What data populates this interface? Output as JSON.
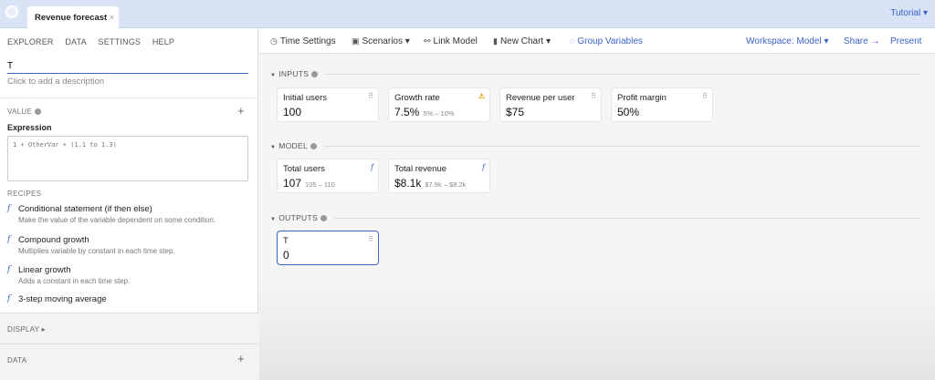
{
  "tabs": {
    "active_tab": "Revenue forecast",
    "close_glyph": "×",
    "tutorial_label": "Tutorial ▾"
  },
  "sidebar": {
    "nav": [
      "EXPLORER",
      "DATA",
      "SETTINGS",
      "HELP"
    ],
    "name_value": "T",
    "description_placeholder": "Click to add a description",
    "value_label": "VALUE",
    "expression_label": "Expression",
    "expression_placeholder": "1 + OtherVar + (1.1 to 1.3)",
    "recipes_label": "RECIPES",
    "recipes": [
      {
        "title": "Conditional statement (if then else)",
        "desc": "Make the value of the variable dependent on some condition."
      },
      {
        "title": "Compound growth",
        "desc": "Multiplies variable by constant in each time step."
      },
      {
        "title": "Linear growth",
        "desc": "Adds a constant in each time step."
      },
      {
        "title": "3-step moving average",
        "desc": ""
      }
    ],
    "display_label": "DISPLAY ▸",
    "data_label": "DATA"
  },
  "toolbar": {
    "time_settings": "Time Settings",
    "scenarios": "Scenarios ▾",
    "link_model": "Link Model",
    "new_chart": "New Chart ▾",
    "group_variables": "Group Variables",
    "workspace": "Workspace: Model ▾",
    "share": "Share →",
    "present": "Present"
  },
  "canvas": {
    "inputs": {
      "label": "INPUTS",
      "cards": [
        {
          "name": "Initial users",
          "value": "100",
          "range": "",
          "icon": "grid-icon"
        },
        {
          "name": "Growth rate",
          "value": "7.5%",
          "range": "5% – 10%",
          "icon": "warning-icon"
        },
        {
          "name": "Revenue per user",
          "value": "$75",
          "range": "",
          "icon": "grid-icon"
        },
        {
          "name": "Profit margin",
          "value": "50%",
          "range": "",
          "icon": "grid-icon"
        }
      ]
    },
    "model": {
      "label": "MODEL",
      "cards": [
        {
          "name": "Total users",
          "value": "107",
          "range": "105 – 110",
          "icon": "function-icon"
        },
        {
          "name": "Total revenue",
          "value": "$8.1k",
          "range": "$7.9k – $8.2k",
          "icon": "function-icon"
        }
      ]
    },
    "outputs": {
      "label": "OUTPUTS",
      "cards": [
        {
          "name": "T",
          "value": "0",
          "range": "",
          "icon": "grid-icon"
        }
      ]
    }
  },
  "colors": {
    "accent": "#3a62c8",
    "warning": "#e3a51c",
    "tabbar": "#d8e4f5"
  }
}
